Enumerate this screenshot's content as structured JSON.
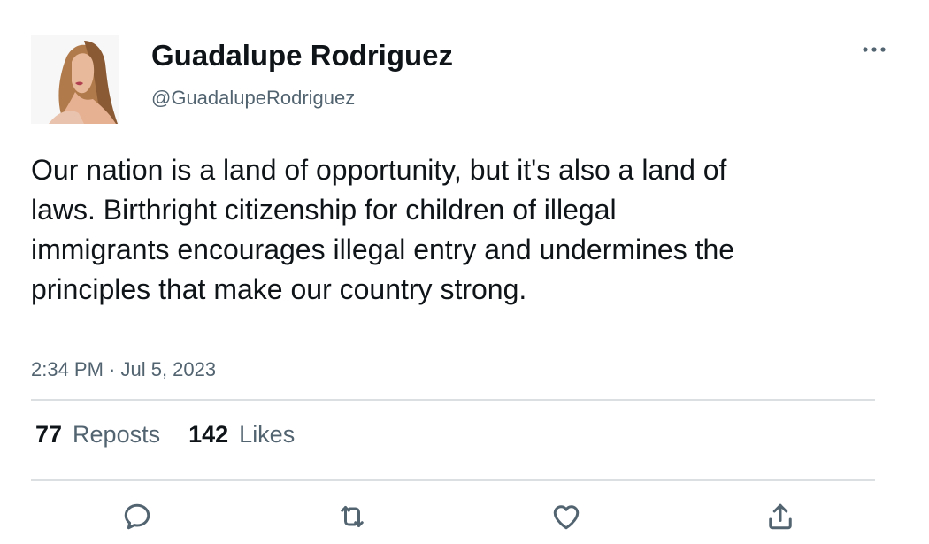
{
  "author": {
    "display_name": "Guadalupe Rodriguez",
    "handle": "@GuadalupeRodriguez",
    "avatar_icon": "profile-photo"
  },
  "tweet": {
    "text": "Our nation is a land of opportunity, but it's also a land of laws. Birthright citizenship for children of illegal immigrants encourages illegal entry and undermines the principles that make our country strong.",
    "timestamp": "2:34 PM · Jul 5, 2023"
  },
  "stats": {
    "reposts_count": "77",
    "reposts_label": "Reposts",
    "likes_count": "142",
    "likes_label": "Likes"
  },
  "actions": {
    "reply_icon": "reply-icon",
    "repost_icon": "repost-icon",
    "like_icon": "like-icon",
    "share_icon": "share-icon",
    "more_icon": "more-icon"
  },
  "colors": {
    "text_primary": "#0f1419",
    "text_secondary": "#536471",
    "divider": "#dcdfe2",
    "background": "#ffffff"
  }
}
